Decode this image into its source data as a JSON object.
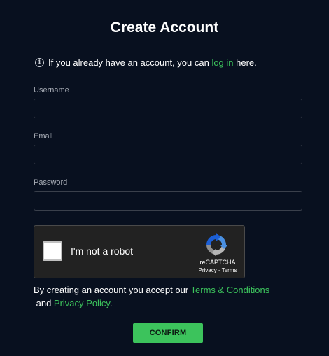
{
  "page": {
    "title": "Create Account"
  },
  "info": {
    "icon": "info-icon",
    "prefix": "If you already have an account, you can ",
    "link": "log in",
    "suffix": " here."
  },
  "form": {
    "username_label": "Username",
    "username_value": "",
    "email_label": "Email",
    "email_value": "",
    "password_label": "Password",
    "password_value": ""
  },
  "captcha": {
    "checkbox_label": "I'm not a robot",
    "checked": false,
    "brand": "reCAPTCHA",
    "privacy": "Privacy",
    "separator": " - ",
    "terms": "Terms",
    "logo_icon": "recaptcha-logo-icon"
  },
  "terms": {
    "prefix": "By creating an account you accept our ",
    "terms_link": "Terms & Conditions",
    "middle": " and ",
    "privacy_link": "Privacy Policy",
    "suffix": "."
  },
  "actions": {
    "confirm_label": "CONFIRM"
  },
  "colors": {
    "background": "#08101f",
    "accent": "#3cc35c",
    "field_border": "#3a404b",
    "captcha_bg": "#222222"
  }
}
